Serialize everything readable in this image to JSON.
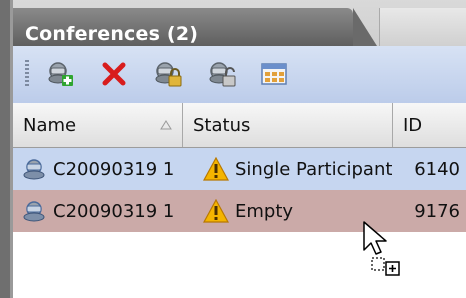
{
  "panel": {
    "title": "Conferences (2)"
  },
  "toolbar": {
    "buttons": [
      {
        "icon": "add-conference-icon"
      },
      {
        "icon": "delete-icon"
      },
      {
        "icon": "lock-conference-icon"
      },
      {
        "icon": "unlock-conference-icon"
      },
      {
        "icon": "layout-grid-icon"
      }
    ]
  },
  "table": {
    "columns": [
      "Name",
      "Status",
      "ID"
    ],
    "rows": [
      {
        "name": "C20090319 1",
        "status": "Single Participant",
        "id": "6140"
      },
      {
        "name": "C20090319 1",
        "status": "Empty",
        "id": "9176"
      }
    ]
  },
  "colors": {
    "selected_row": "#c6d6f0",
    "drag_row": "#cbaaa8",
    "title_bg": "#6f6f6f",
    "toolbar_bg": "#c9d6ee"
  }
}
